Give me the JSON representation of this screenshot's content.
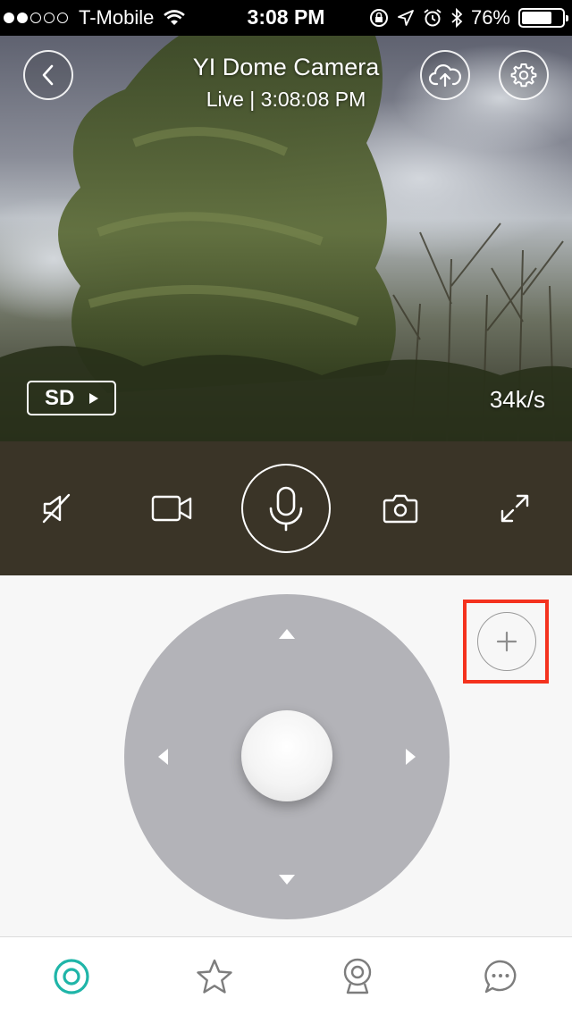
{
  "status_bar": {
    "carrier": "T-Mobile",
    "time": "3:08 PM",
    "battery_percent": "76%",
    "battery_level": 0.76,
    "signal_bars_filled": 2,
    "signal_bars_total": 5
  },
  "camera": {
    "title": "YI Dome Camera",
    "subtitle": "Live | 3:08:08 PM",
    "quality_label": "SD",
    "bitrate": "34k/s"
  },
  "controls": {
    "items": [
      "mute-toggle",
      "record-video",
      "microphone",
      "snapshot",
      "fullscreen"
    ]
  },
  "ptz": {
    "directions": [
      "up",
      "down",
      "left",
      "right"
    ],
    "add_preset_symbol": "+"
  },
  "tab_bar": {
    "tabs": [
      "home",
      "favorites",
      "cameras",
      "messages"
    ],
    "active_tab": "home"
  },
  "colors": {
    "accent_teal": "#1fb5a8",
    "control_bar": "#3a3427",
    "joystick": "#b3b3b8",
    "highlight_red": "#f4321e",
    "tab_icon_gray": "#7d7d7d"
  }
}
